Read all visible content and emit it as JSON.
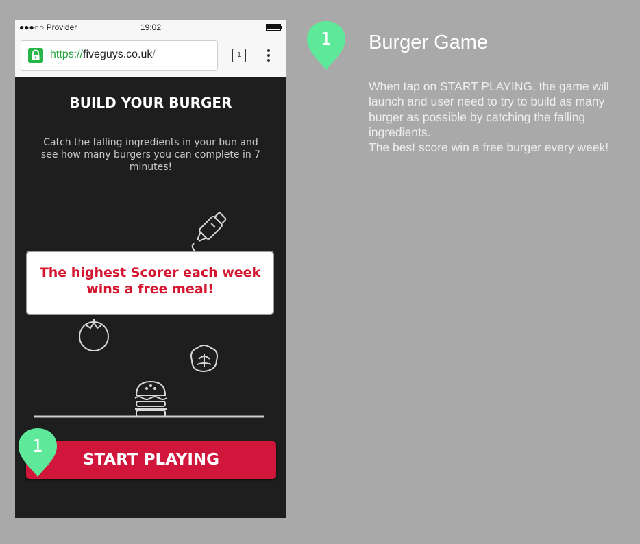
{
  "status_bar": {
    "carrier": "●●●○○ Provider",
    "time": "19:02"
  },
  "browser": {
    "url_scheme": "https://",
    "url_host": "fiveguys.co.uk",
    "url_path": "/",
    "tab_count": "1",
    "lock_icon": "lock-icon",
    "more_icon": "more-vertical-icon"
  },
  "game": {
    "title": "BUILD YOUR BURGER",
    "description": "Catch the falling ingredients in your bun and see how many burgers you can complete in 7 minutes!",
    "promo_line1": "The highest Scorer each week",
    "promo_line2": "wins a free meal!",
    "start_label": "START PLAYING",
    "icons": [
      "sauce-bottle-icon",
      "tomato-icon",
      "lettuce-icon",
      "burger-icon"
    ]
  },
  "annotation": {
    "marker_number": "1",
    "title": "Burger Game",
    "description": "When tap on START PLAYING, the game will launch and user need to try to build as many burger as possible by catching the falling ingredients.\nThe best score win a free burger every week!"
  },
  "colors": {
    "marker": "#5ee89a",
    "accent_red": "#d0173b",
    "promo_text": "#d4152f",
    "game_bg": "#1e1e1e",
    "page_bg": "#a9a9a9"
  }
}
